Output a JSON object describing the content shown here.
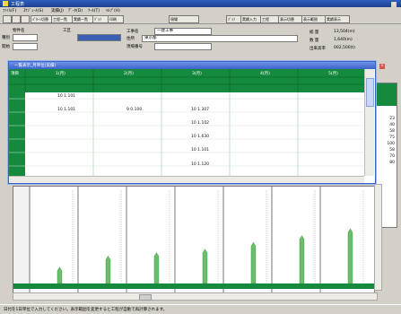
{
  "window": {
    "title": "工程表"
  },
  "menu": [
    "ﾌｧｲﾙ(F)",
    "ｽｹｼﾞｭｰﾙ(S)",
    "実績(J)",
    "ﾃﾞｰﾀ(D)",
    "ﾂｰﾙ(T)",
    "ﾍﾙﾌﾟ(H)"
  ],
  "toolbar": {
    "buttons": [
      "ﾊﾟﾀｰﾝ切替",
      "工程一覧",
      "実績一覧",
      "ｸﾞﾗﾌ",
      "印刷"
    ],
    "right_buttons": [
      "現場",
      "ｸﾞﾗﾌ",
      "実績入力",
      "工程",
      "表示切替",
      "表示範囲",
      "実績表示"
    ]
  },
  "info": {
    "labels": [
      "物件名",
      "工区",
      "種別",
      "工事名",
      "住所",
      "開始"
    ],
    "project_name": "一建工事",
    "address": "東京都",
    "code_label": "現場番号",
    "right_labels": [
      "総 量",
      "数 量",
      "出来高率"
    ],
    "total": "13,504(m)",
    "quantity": "1,640(m)",
    "rate": "002,500(t)"
  },
  "dialog": {
    "title": "一覧表示_月単位(実績)",
    "first_col_header": "項目",
    "months": [
      "1(月)",
      "2(月)",
      "3(月)",
      "4(月)",
      "5(月)"
    ],
    "row_values": [
      [
        "10 1.101",
        "",
        ""
      ],
      [
        "10 1.101",
        "9 0.100",
        "10 1.307"
      ],
      [
        "",
        "",
        "10 1.102"
      ],
      [
        "",
        "",
        "10 1.630"
      ],
      [
        "",
        "",
        "10 1.101"
      ],
      [
        "",
        "",
        "10 1.120"
      ]
    ]
  },
  "right_list": {
    "values": [
      "23",
      "40",
      "58",
      "75",
      "100",
      "58",
      "70",
      "80"
    ]
  },
  "chart_data": {
    "type": "bar",
    "values": [
      15,
      28,
      32,
      36,
      44,
      52,
      60
    ]
  },
  "status": {
    "text": "日付を1日単位で入力してください。表示範囲を変更すると工程が自動で再計算されます。"
  },
  "colors": {
    "grid_green": "#158a3e",
    "bar_green": "#6bbf6a",
    "title_blue": "#2d5fbf"
  },
  "icons": [
    "app-icon",
    "save-icon",
    "open-icon",
    "print-icon",
    "close-icon",
    "minimize-icon",
    "maximize-icon"
  ]
}
